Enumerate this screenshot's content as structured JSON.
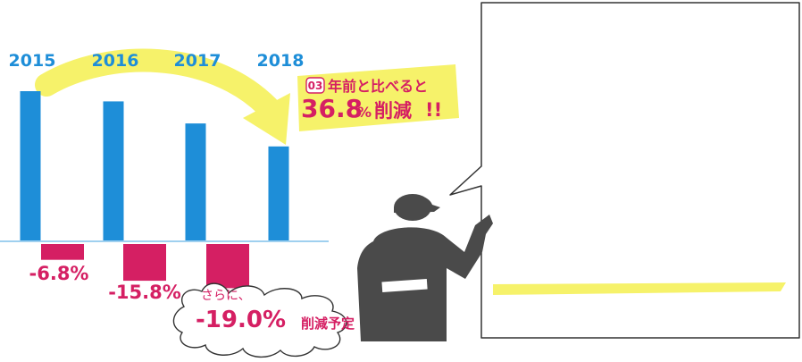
{
  "chart_data": {
    "type": "bar",
    "categories": [
      "2015",
      "2016",
      "2017",
      "2018"
    ],
    "series": [
      {
        "values": [
          100,
          93.2,
          78.5,
          63.2
        ]
      }
    ],
    "change_labels": [
      "-6.8%",
      "-15.8%",
      "-19.0%"
    ],
    "change_values": [
      -6.8,
      -15.8,
      -19.0
    ],
    "colors": {
      "bars": "#1e8ed8",
      "change_bars": "#d51f63",
      "baseline": "#9fd0ef",
      "highlight": "#f6f26a"
    }
  },
  "annotations": {
    "further": "さらに、",
    "reduction_plan": "削減予定",
    "badge_number": "03",
    "compare_text": "年前と比べると",
    "reduction_total": "36.8",
    "reduction_total_unit": "%",
    "reduction_word": "削減",
    "exclaim": "!!"
  },
  "icons": [
    "presenter-figure-icon",
    "speech-bubble-icon",
    "curved-arrow-icon",
    "jagged-callout-icon"
  ]
}
